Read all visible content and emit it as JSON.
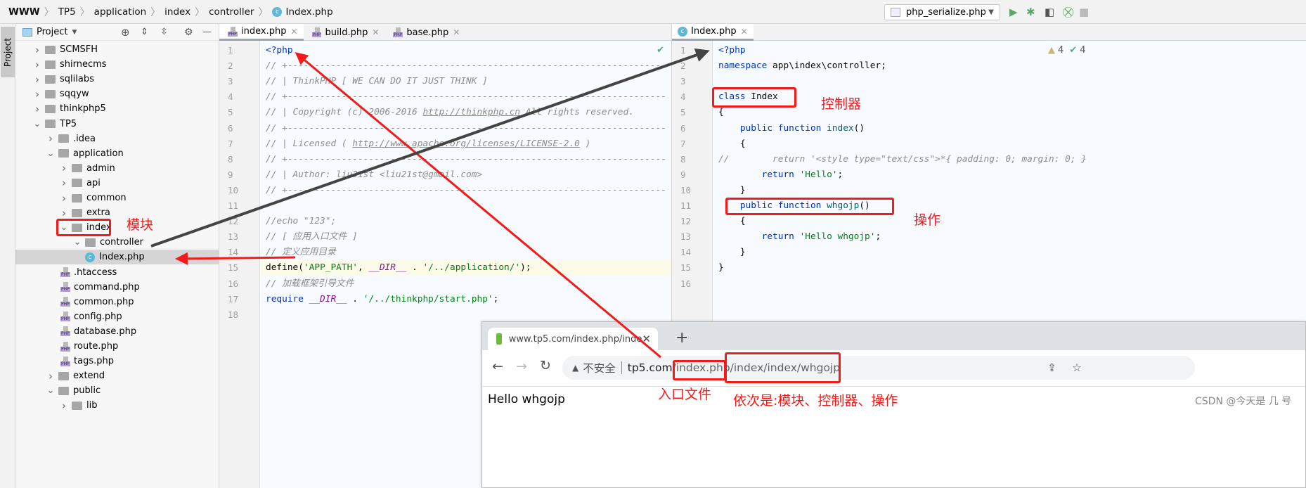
{
  "breadcrumb": [
    "WWW",
    "TP5",
    "application",
    "index",
    "controller",
    "Index.php"
  ],
  "toolbar": {
    "run_config": "php_serialize.php",
    "icons": [
      "run-icon",
      "debug-icon",
      "coverage-icon",
      "debug-stop-icon",
      "stop-icon"
    ],
    "accent_green": "#59a869"
  },
  "side_strip": {
    "label": "Project"
  },
  "project": {
    "title": "Project",
    "tree": [
      {
        "label": "SCMSFH",
        "type": "folder",
        "depth": 0,
        "open": false
      },
      {
        "label": "shirnecms",
        "type": "folder",
        "depth": 0,
        "open": false
      },
      {
        "label": "sqlilabs",
        "type": "folder",
        "depth": 0,
        "open": false
      },
      {
        "label": "sqqyw",
        "type": "folder",
        "depth": 0,
        "open": false
      },
      {
        "label": "thinkphp5",
        "type": "folder",
        "depth": 0,
        "open": false
      },
      {
        "label": "TP5",
        "type": "folder",
        "depth": 0,
        "open": true
      },
      {
        "label": ".idea",
        "type": "folder",
        "depth": 1,
        "open": false
      },
      {
        "label": "application",
        "type": "folder",
        "depth": 1,
        "open": true
      },
      {
        "label": "admin",
        "type": "folder",
        "depth": 2,
        "open": false
      },
      {
        "label": "api",
        "type": "folder",
        "depth": 2,
        "open": false
      },
      {
        "label": "common",
        "type": "folder",
        "depth": 2,
        "open": false
      },
      {
        "label": "extra",
        "type": "folder",
        "depth": 2,
        "open": false
      },
      {
        "label": "index",
        "type": "folder",
        "depth": 2,
        "open": true
      },
      {
        "label": "controller",
        "type": "folder",
        "depth": 3,
        "open": true
      },
      {
        "label": "Index.php",
        "type": "class",
        "depth": 4,
        "selected": true
      },
      {
        "label": ".htaccess",
        "type": "file",
        "depth": 2
      },
      {
        "label": "command.php",
        "type": "php",
        "depth": 2
      },
      {
        "label": "common.php",
        "type": "php",
        "depth": 2
      },
      {
        "label": "config.php",
        "type": "php",
        "depth": 2
      },
      {
        "label": "database.php",
        "type": "php",
        "depth": 2
      },
      {
        "label": "route.php",
        "type": "php",
        "depth": 2
      },
      {
        "label": "tags.php",
        "type": "php",
        "depth": 2
      },
      {
        "label": "extend",
        "type": "folder",
        "depth": 1,
        "open": false
      },
      {
        "label": "public",
        "type": "folder",
        "depth": 1,
        "open": true
      },
      {
        "label": "lib",
        "type": "folder",
        "depth": 2,
        "open": false
      }
    ]
  },
  "left_editor": {
    "tabs": [
      {
        "label": "index.php",
        "active": true
      },
      {
        "label": "build.php"
      },
      {
        "label": "base.php"
      }
    ],
    "lines": [
      [
        [
          "<?php",
          "kw"
        ]
      ],
      [
        [
          "// +----------------------------------------------------------------------",
          "cm"
        ]
      ],
      [
        [
          "// | ThinkPHP [ WE CAN DO IT JUST THINK ]",
          "cm"
        ]
      ],
      [
        [
          "// +----------------------------------------------------------------------",
          "cm"
        ]
      ],
      [
        [
          "// | Copyright (c) 2006-2016 ",
          "cm"
        ],
        [
          "http://thinkphp.cn",
          "cm ul"
        ],
        [
          " All rights reserved.",
          "cm"
        ]
      ],
      [
        [
          "// +----------------------------------------------------------------------",
          "cm"
        ]
      ],
      [
        [
          "// | Licensed ( ",
          "cm"
        ],
        [
          "http://www.apache.org/licenses/LICENSE-2.0",
          "cm ul"
        ],
        [
          " )",
          "cm"
        ]
      ],
      [
        [
          "// +----------------------------------------------------------------------",
          "cm"
        ]
      ],
      [
        [
          "// | Author: liu21st <liu21st@gmail.com>",
          "cm"
        ]
      ],
      [
        [
          "// +----------------------------------------------------------------------",
          "cm"
        ]
      ],
      [],
      [
        [
          "//echo \"123\";",
          "cm"
        ]
      ],
      [
        [
          "// [ 应用入口文件 ]",
          "cm"
        ]
      ],
      [
        [
          "// 定义应用目录",
          "cm"
        ]
      ],
      [
        [
          "define",
          "pl"
        ],
        [
          "(",
          "pl"
        ],
        [
          "'APP_PATH'",
          "st"
        ],
        [
          ", ",
          "pl"
        ],
        [
          "__DIR__",
          "cn"
        ],
        [
          " . ",
          "pl"
        ],
        [
          "'/../application/'",
          "st"
        ],
        [
          ");",
          "pl"
        ]
      ],
      [
        [
          "// 加载框架引导文件",
          "cm"
        ]
      ],
      [
        [
          "require ",
          "kw"
        ],
        [
          "__DIR__",
          "cn"
        ],
        [
          " . ",
          "pl"
        ],
        [
          "'/../thinkphp/start.php'",
          "st"
        ],
        [
          ";",
          "pl"
        ]
      ],
      []
    ]
  },
  "right_editor": {
    "tabs": [
      {
        "label": "Index.php",
        "active": true
      }
    ],
    "inspections": {
      "warnings": "4",
      "ok": "4"
    },
    "lines": [
      [
        [
          "<?php",
          "kw"
        ]
      ],
      [
        [
          "namespace ",
          "kw"
        ],
        [
          "app\\index\\controller;",
          "pl"
        ]
      ],
      [],
      [
        [
          "class ",
          "kw"
        ],
        [
          "Index",
          "pl"
        ]
      ],
      [
        [
          "{",
          "pl"
        ]
      ],
      [
        [
          "    public function ",
          "kw"
        ],
        [
          "index",
          "fn"
        ],
        [
          "()",
          "pl"
        ]
      ],
      [
        [
          "    {",
          "pl"
        ]
      ],
      [
        [
          "//        return '<style type=\"text/css\">*{ padding: 0; margin: 0; }",
          "cm"
        ]
      ],
      [
        [
          "        return ",
          "kw"
        ],
        [
          "'Hello'",
          "st"
        ],
        [
          ";",
          "pl"
        ]
      ],
      [
        [
          "    }",
          "pl"
        ]
      ],
      [
        [
          "    public function ",
          "kw"
        ],
        [
          "whgojp",
          "fn"
        ],
        [
          "()",
          "pl"
        ]
      ],
      [
        [
          "    {",
          "pl"
        ]
      ],
      [
        [
          "        return ",
          "kw"
        ],
        [
          "'Hello whgojp'",
          "st"
        ],
        [
          ";",
          "pl"
        ]
      ],
      [
        [
          "    }",
          "pl"
        ]
      ],
      [
        [
          "}",
          "pl"
        ]
      ],
      []
    ]
  },
  "browser": {
    "tab_title": "www.tp5.com/index.php/inde",
    "new_tab": "+",
    "security": "不安全",
    "url_host": "tp5.com",
    "url_entry": "/index.php",
    "url_path": "/index/index/whgojp",
    "content": "Hello whgojp"
  },
  "annotations": {
    "module": "模块",
    "controller": "控制器",
    "action": "操作",
    "entry": "入口文件",
    "order": "依次是:模块、控制器、操作",
    "color": "#f21a1a"
  },
  "watermark": "CSDN @今天是 几 号"
}
